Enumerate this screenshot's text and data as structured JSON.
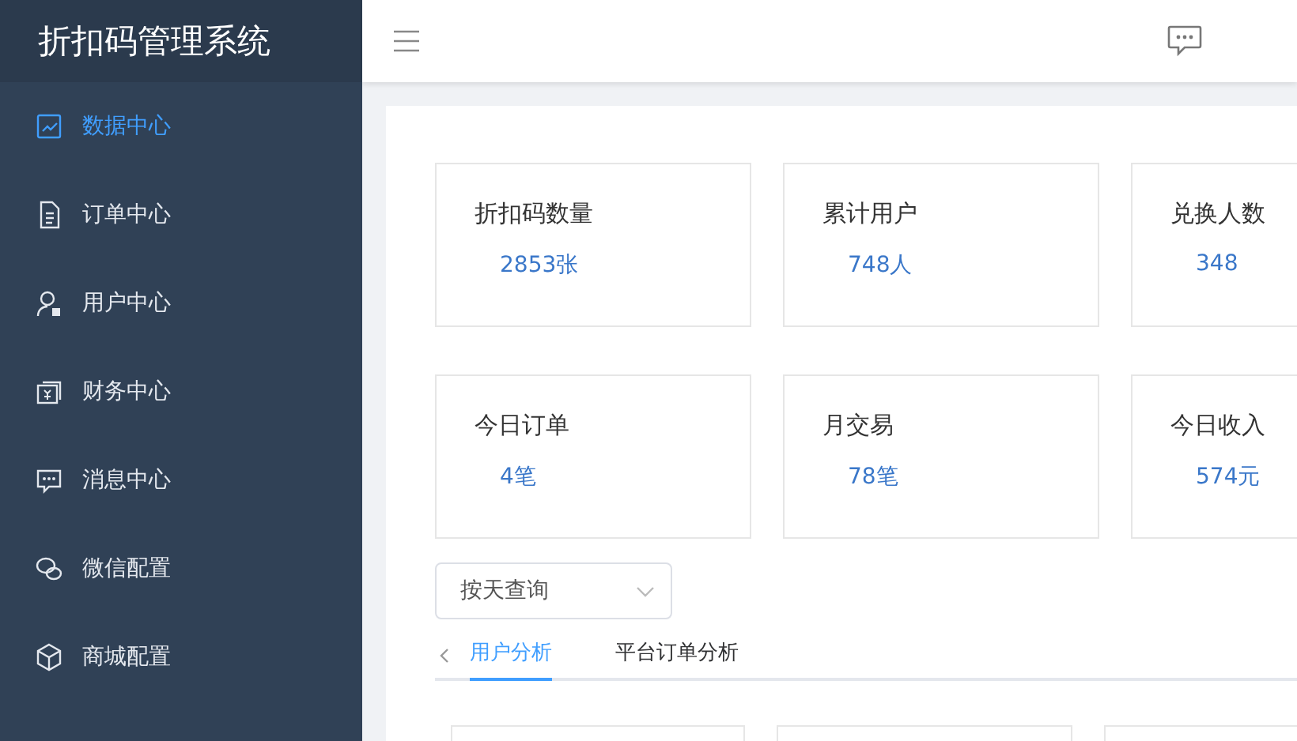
{
  "sidebar": {
    "title": "折扣码管理系统",
    "items": [
      {
        "label": "数据中心",
        "selected": true
      },
      {
        "label": "订单中心",
        "selected": false
      },
      {
        "label": "用户中心",
        "selected": false
      },
      {
        "label": "财务中心",
        "selected": false
      },
      {
        "label": "消息中心",
        "selected": false
      },
      {
        "label": "微信配置",
        "selected": false
      },
      {
        "label": "商城配置",
        "selected": false
      }
    ]
  },
  "stats": [
    {
      "label": "折扣码数量",
      "value": "2853张"
    },
    {
      "label": "累计用户",
      "value": "748人"
    },
    {
      "label": "兑换人数",
      "value": "348"
    },
    {
      "label": "今日订单",
      "value": "4笔"
    },
    {
      "label": "月交易",
      "value": "78笔"
    },
    {
      "label": "今日收入",
      "value": "574元"
    }
  ],
  "filter": {
    "value": "按天查询"
  },
  "tabs": [
    {
      "label": "用户分析",
      "selected": true
    },
    {
      "label": "平台订单分析",
      "selected": false
    }
  ]
}
